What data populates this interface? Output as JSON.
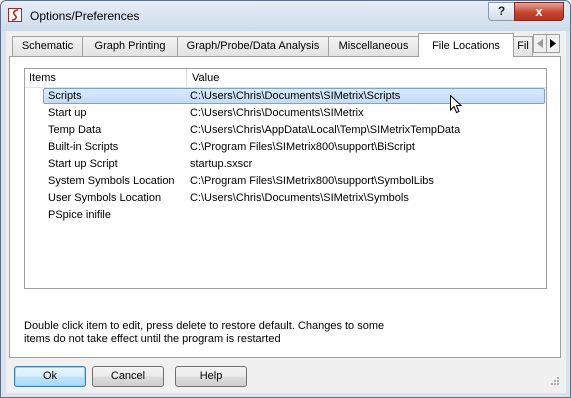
{
  "window": {
    "title": "Options/Preferences",
    "help_label": "?",
    "close_label": "x"
  },
  "tabs": [
    {
      "label": "Schematic",
      "active": false
    },
    {
      "label": "Graph Printing",
      "active": false
    },
    {
      "label": "Graph/Probe/Data Analysis",
      "active": false
    },
    {
      "label": "Miscellaneous",
      "active": false
    },
    {
      "label": "File Locations",
      "active": true
    },
    {
      "label": "Fil",
      "active": false
    }
  ],
  "tab_scroll": {
    "left_icon": "triangle-left-icon",
    "right_icon": "triangle-right-icon"
  },
  "list": {
    "columns": {
      "items": "Items",
      "value": "Value"
    },
    "selected_index": 0,
    "rows": [
      {
        "item": "Scripts",
        "value": "C:\\Users\\Chris\\Documents\\SIMetrix\\Scripts"
      },
      {
        "item": "Start up",
        "value": "C:\\Users\\Chris\\Documents\\SIMetrix"
      },
      {
        "item": "Temp Data",
        "value": "C:\\Users\\Chris\\AppData\\Local\\Temp\\SIMetrixTempData"
      },
      {
        "item": "Built-in Scripts",
        "value": "C:\\Program Files\\SIMetrix800\\support\\BiScript"
      },
      {
        "item": "Start up Script",
        "value": "startup.sxscr"
      },
      {
        "item": "System Symbols Location",
        "value": "C:\\Program Files\\SIMetrix800\\support\\SymbolLibs"
      },
      {
        "item": "User Symbols Location",
        "value": "C:\\Users\\Chris\\Documents\\SIMetrix\\Symbols"
      },
      {
        "item": "PSpice inifile",
        "value": ""
      }
    ]
  },
  "hint": "Double click item to edit, press delete to restore default. Changes to some items do not take effect until the program is restarted",
  "buttons": {
    "ok": "Ok",
    "cancel": "Cancel",
    "help": "Help"
  }
}
